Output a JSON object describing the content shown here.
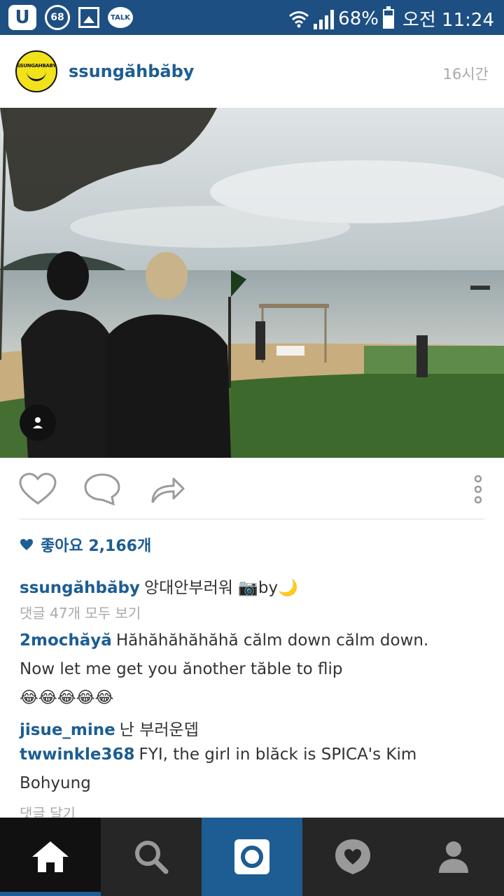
{
  "status_bar": {
    "left_icons": [
      "U",
      "68",
      "gallery-icon",
      "TALK"
    ],
    "battery": "68%",
    "time": "오전 11:24"
  },
  "post": {
    "avatar_text": "SSUNGAHBABY",
    "username": "ssungăhbăby",
    "time_ago": "16시간",
    "likes": "좋아요 2,166개",
    "caption_user": "ssungăhbăby",
    "caption_text": "앙대안부러워 📷by🌙",
    "view_all_comments": "댓글 47개 모두 보기",
    "comments": [
      {
        "user": "2mochăyă",
        "text": "Hăhăhăhăhăhă călm down călm down."
      },
      {
        "user": "",
        "text": "Now let me get you ănother tăble to flip"
      },
      {
        "user": "",
        "text": "😂😂😂😂😂"
      },
      {
        "user": "jisue_mine",
        "text": "난 부러운뎁"
      },
      {
        "user": "twwinkle368",
        "text": "FYI, the girl in blăck is SPICA's Kim"
      },
      {
        "user": "",
        "text": "Bohyung"
      }
    ],
    "add_comment": "댓글 달기"
  },
  "colors": {
    "brand_blue": "#1d5d93",
    "status_bar": "#1d4f82",
    "nav_bg": "#262626"
  },
  "nav": [
    "home-icon",
    "search-icon",
    "camera-icon",
    "activity-heart-icon",
    "profile-icon"
  ]
}
